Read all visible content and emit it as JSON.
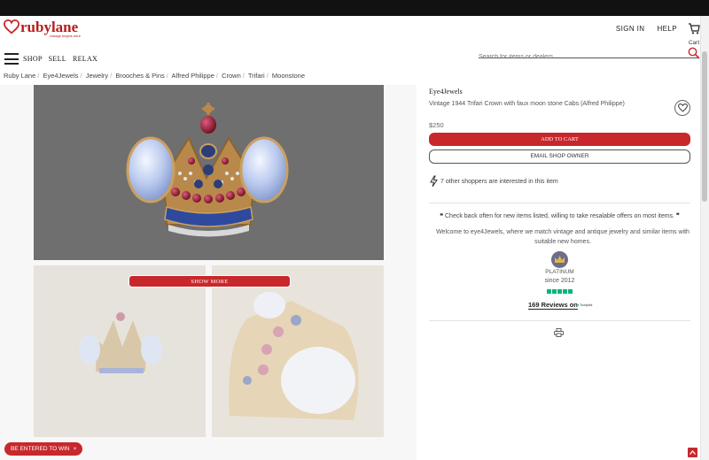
{
  "brand": {
    "name": "rubylane",
    "tagline": "vintage begins here"
  },
  "header": {
    "signin_label": "SIGN IN",
    "help_label": "HELP",
    "cart_label": "Cart",
    "nav": [
      "SHOP",
      "SELL",
      "RELAX"
    ],
    "search_placeholder": "Search for items or dealers"
  },
  "breadcrumb": [
    "Ruby Lane",
    "Eye4Jewels",
    "Jewelry",
    "Brooches & Pins",
    "Alfred Philippe",
    "Crown",
    "Trifari",
    "Moonstone"
  ],
  "gallery": {
    "show_more_label": "SHOW MORE"
  },
  "item": {
    "dealer": "Eye4Jewels",
    "title": "Vintage 1944 Trifari Crown with faux moon stone Cabs (Alfred Philippe)",
    "price": "$250",
    "add_to_cart_label": "ADD TO CART",
    "email_label": "EMAIL SHOP OWNER",
    "interest_text": "7 other shoppers are interested in this item"
  },
  "shop": {
    "quote_open": "❝",
    "quote_text": "Check back often for new items listed, willing to take resalable offers on most items.",
    "quote_close": "❞",
    "welcome": "Welcome to eye4Jewels, where we match vintage and antique jewelry and similar items with suitable new homes.",
    "tier": "PLATINUM",
    "since": "since 2012",
    "reviews": "169 Reviews on",
    "trustpilot": "Trustpilot",
    "rating_stars": 5
  },
  "promo": {
    "label": "BE ENTERED TO WIN",
    "close": "×"
  },
  "colors": {
    "brand_red": "#c8282c",
    "trustpilot_green": "#00b67a",
    "platinum_badge": "#6d6d8a"
  },
  "icons": [
    "heart-logo-icon",
    "cart-icon",
    "hamburger-icon",
    "search-icon",
    "favorite-heart-icon",
    "lightning-icon",
    "crown-badge-icon",
    "printer-icon",
    "back-to-top-icon"
  ]
}
